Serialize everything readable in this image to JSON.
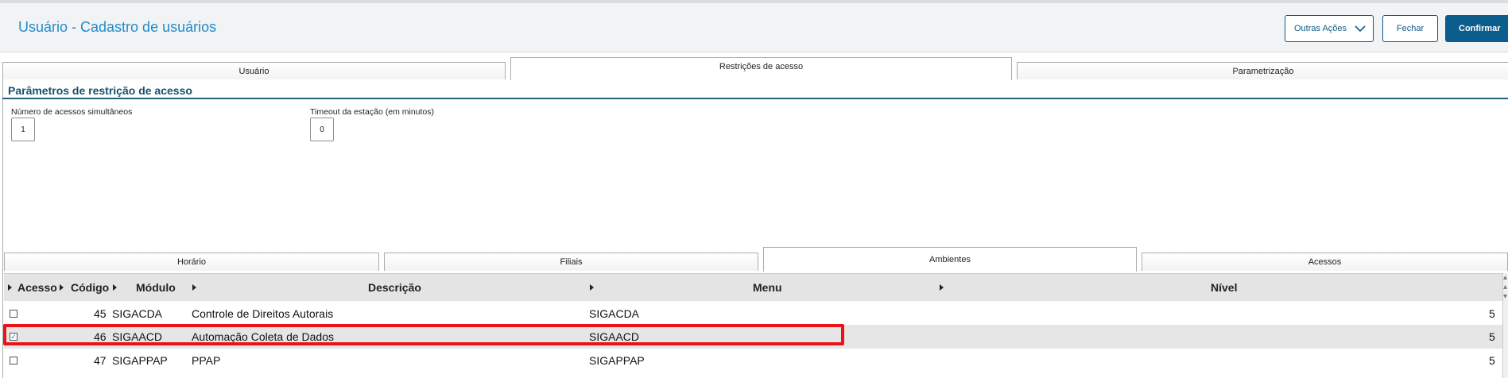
{
  "header": {
    "title": "Usuário - Cadastro de usuários",
    "buttons": {
      "outras_acoes": "Outras Ações",
      "fechar": "Fechar",
      "confirmar": "Confirmar"
    }
  },
  "main_tabs": [
    "Usuário",
    "Restrições de acesso",
    "Parametrização"
  ],
  "section": {
    "title": "Parâmetros de restrição de acesso",
    "fields": [
      {
        "label": "Número de acessos simultâneos",
        "value": "1"
      },
      {
        "label": "Timeout da estação (em minutos)",
        "value": "0"
      }
    ]
  },
  "sub_tabs": [
    "Horário",
    "Filiais",
    "Ambientes",
    "Acessos"
  ],
  "grid": {
    "columns": [
      "Acesso",
      "Código",
      "Módulo",
      "Descrição",
      "Menu",
      "Nível"
    ],
    "rows": [
      {
        "checked": false,
        "codigo": "45",
        "modulo": "SIGACDA",
        "descricao": "Controle de Direitos Autorais",
        "menu": "SIGACDA",
        "nivel": "5"
      },
      {
        "checked": true,
        "codigo": "46",
        "modulo": "SIGAACD",
        "descricao": "Automação Coleta de Dados",
        "menu": "SIGAACD",
        "nivel": "5"
      },
      {
        "checked": false,
        "codigo": "47",
        "modulo": "SIGAPPAP",
        "descricao": "PPAP",
        "menu": "SIGAPPAP",
        "nivel": "5"
      }
    ]
  },
  "colors": {
    "title": "#1e8cc9",
    "primary_button": "#0d5d8c",
    "section_title": "#16506e",
    "highlight": "#e8141a"
  },
  "icons": {
    "dropdown": "chevron-down-icon",
    "sort": "sort-arrow-icon",
    "checkbox": "checkbox-icon"
  }
}
